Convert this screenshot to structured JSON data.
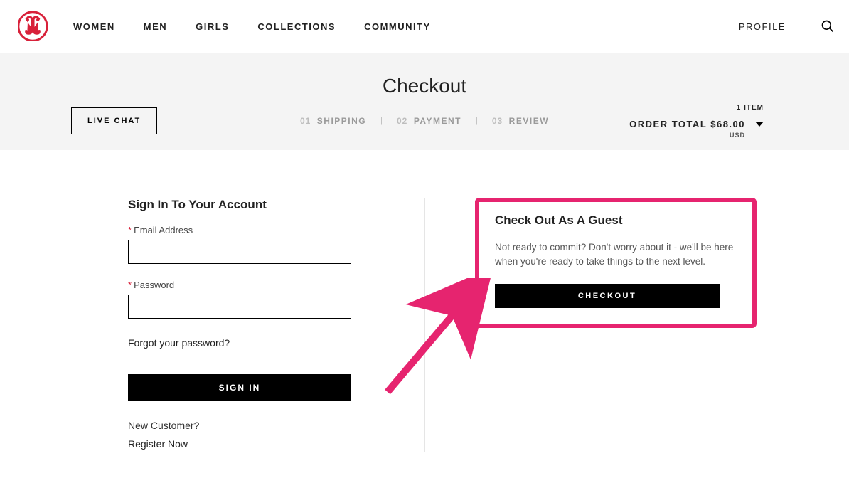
{
  "nav": {
    "links": [
      "WOMEN",
      "MEN",
      "GIRLS",
      "COLLECTIONS",
      "COMMUNITY"
    ],
    "profile": "PROFILE"
  },
  "band": {
    "title": "Checkout",
    "live_chat": "LIVE CHAT",
    "steps": [
      {
        "num": "01",
        "label": "SHIPPING"
      },
      {
        "num": "02",
        "label": "PAYMENT"
      },
      {
        "num": "03",
        "label": "REVIEW"
      }
    ],
    "item_count": "1 ITEM",
    "order_total_label": "ORDER TOTAL",
    "order_total_value": "$68.00",
    "currency": "USD"
  },
  "signin": {
    "title": "Sign In To Your Account",
    "email_label": "Email Address",
    "password_label": "Password",
    "forgot": "Forgot your password?",
    "button": "SIGN IN",
    "new_customer": "New Customer?",
    "register": "Register Now"
  },
  "guest": {
    "title": "Check Out As A Guest",
    "desc": "Not ready to commit? Don't worry about it - we'll be here when you're ready to take things to the next level.",
    "button": "CHECKOUT"
  },
  "colors": {
    "brand_red": "#d8213a",
    "highlight_pink": "#e6246f"
  }
}
